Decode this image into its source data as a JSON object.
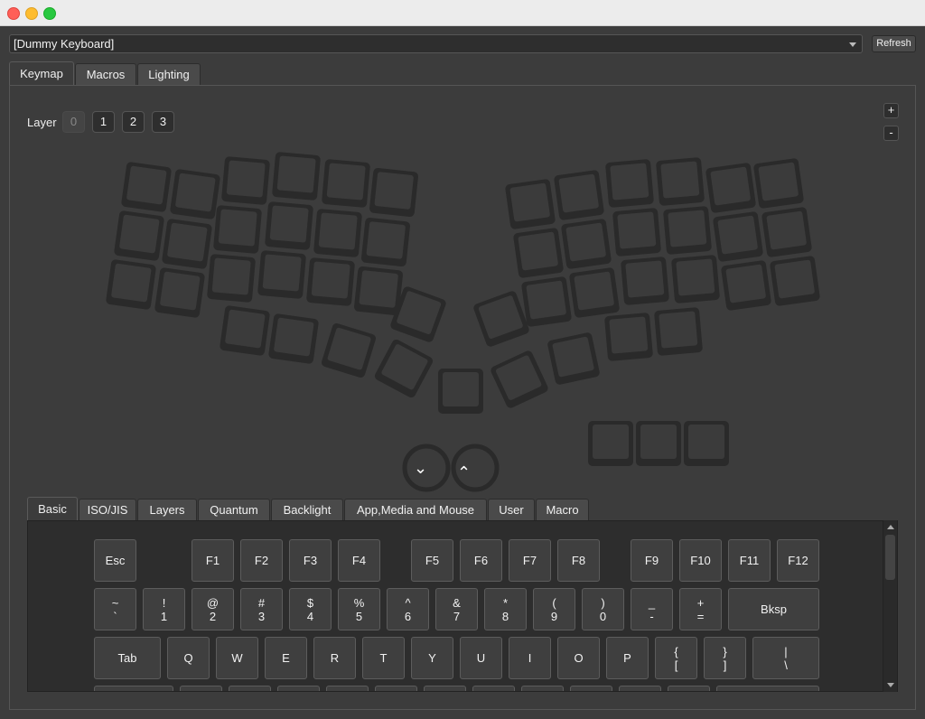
{
  "keyboard_select": {
    "value": "[Dummy Keyboard]"
  },
  "refresh_label": "Refresh",
  "main_tabs": [
    {
      "label": "Keymap",
      "active": true
    },
    {
      "label": "Macros",
      "active": false
    },
    {
      "label": "Lighting",
      "active": false
    }
  ],
  "layer": {
    "label": "Layer",
    "buttons": [
      "0",
      "1",
      "2",
      "3"
    ],
    "active": "0"
  },
  "zoom": {
    "plus": "+",
    "minus": "-"
  },
  "encoders": {
    "left_symbol": "⌄",
    "right_symbol": "⌃"
  },
  "keycode_tabs": [
    {
      "label": "Basic",
      "active": true
    },
    {
      "label": "ISO/JIS",
      "active": false
    },
    {
      "label": "Layers",
      "active": false
    },
    {
      "label": "Quantum",
      "active": false
    },
    {
      "label": "Backlight",
      "active": false
    },
    {
      "label": "App,Media and Mouse",
      "active": false
    },
    {
      "label": "User",
      "active": false
    },
    {
      "label": "Macro",
      "active": false
    }
  ],
  "keycodes": {
    "row1": [
      "Esc",
      "F1",
      "F2",
      "F3",
      "F4",
      "F5",
      "F6",
      "F7",
      "F8",
      "F9",
      "F10",
      "F11",
      "F12"
    ],
    "row2": [
      {
        "top": "~",
        "bottom": "`"
      },
      {
        "top": "!",
        "bottom": "1"
      },
      {
        "top": "@",
        "bottom": "2"
      },
      {
        "top": "#",
        "bottom": "3"
      },
      {
        "top": "$",
        "bottom": "4"
      },
      {
        "top": "%",
        "bottom": "5"
      },
      {
        "top": "^",
        "bottom": "6"
      },
      {
        "top": "&",
        "bottom": "7"
      },
      {
        "top": "*",
        "bottom": "8"
      },
      {
        "top": "(",
        "bottom": "9"
      },
      {
        "top": ")",
        "bottom": "0"
      },
      {
        "top": "_",
        "bottom": "-"
      },
      {
        "top": "+",
        "bottom": "="
      },
      {
        "top": "Bksp",
        "bottom": ""
      }
    ],
    "row3": [
      {
        "top": "Tab",
        "bottom": ""
      },
      {
        "top": "Q",
        "bottom": ""
      },
      {
        "top": "W",
        "bottom": ""
      },
      {
        "top": "E",
        "bottom": ""
      },
      {
        "top": "R",
        "bottom": ""
      },
      {
        "top": "T",
        "bottom": ""
      },
      {
        "top": "Y",
        "bottom": ""
      },
      {
        "top": "U",
        "bottom": ""
      },
      {
        "top": "I",
        "bottom": ""
      },
      {
        "top": "O",
        "bottom": ""
      },
      {
        "top": "P",
        "bottom": ""
      },
      {
        "top": "{",
        "bottom": "["
      },
      {
        "top": "}",
        "bottom": "]"
      },
      {
        "top": "|",
        "bottom": "\\"
      }
    ]
  },
  "colors": {
    "window_bg": "#3c3c3c",
    "key_outline": "#2a2a2a",
    "key_inner": "#3b3b3b",
    "keycode_bg": "#3f3f3f"
  }
}
